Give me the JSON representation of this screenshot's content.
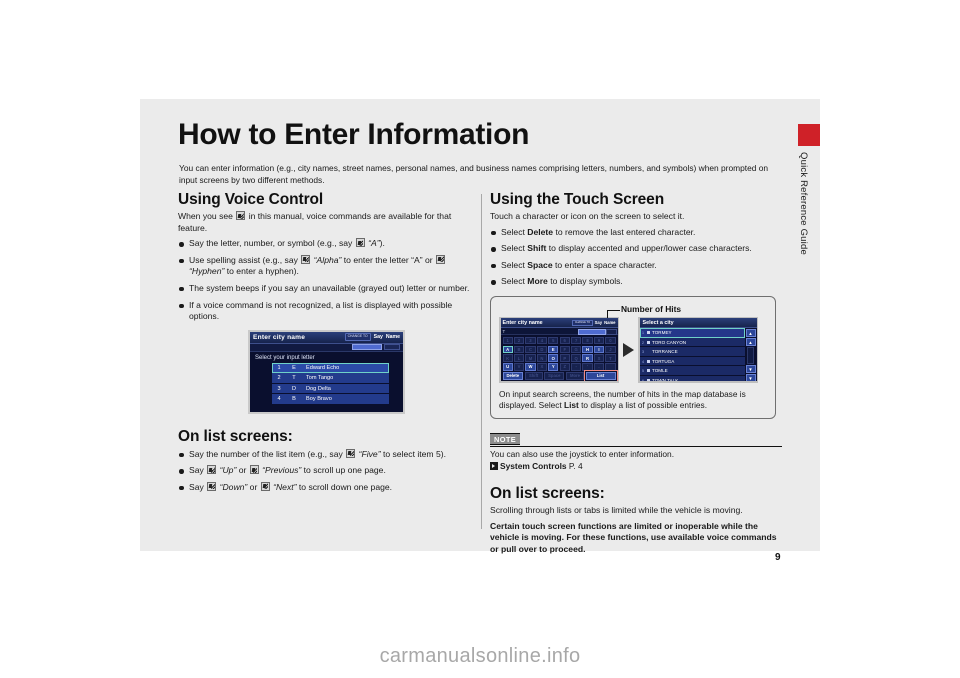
{
  "sheet": {
    "page_number": "9",
    "side_tab_label": "Quick Reference Guide",
    "side_tab_color": "#cf2128",
    "background": "#ebebeb"
  },
  "title": "How to Enter Information",
  "intro": "You can enter information (e.g., city names, street names, personal names, and business names comprising letters, numbers, and symbols) when prompted on input screens by two different methods.",
  "left_column": {
    "heading": "Using Voice Control",
    "lead_part1": "When you see",
    "lead_part2": "in this manual, voice commands are available for that feature.",
    "bullets": [
      {
        "segments": [
          {
            "type": "text",
            "value": "Say the letter, number, or symbol (e.g., say "
          },
          {
            "type": "icon",
            "value": "voice-icon"
          },
          {
            "type": "italic",
            "value": " “A”"
          },
          {
            "type": "text",
            "value": ")."
          }
        ]
      },
      {
        "segments": [
          {
            "type": "text",
            "value": "Use spelling assist (e.g., say "
          },
          {
            "type": "icon",
            "value": "voice-icon"
          },
          {
            "type": "italic",
            "value": " “Alpha”"
          },
          {
            "type": "text",
            "value": " to enter the letter “A” or "
          },
          {
            "type": "icon",
            "value": "voice-icon"
          },
          {
            "type": "italic",
            "value": " “Hyphen”"
          },
          {
            "type": "text",
            "value": " to enter a hyphen)."
          }
        ]
      },
      {
        "segments": [
          {
            "type": "text",
            "value": "The system beeps if you say an unavailable (grayed out) letter or number."
          }
        ]
      },
      {
        "segments": [
          {
            "type": "text",
            "value": "If a voice command is not recognized, a list is displayed with possible options."
          }
        ]
      }
    ],
    "list_heading": "On list screens:",
    "list_bullets": [
      {
        "segments": [
          {
            "type": "text",
            "value": "Say the number of the list item (e.g., say "
          },
          {
            "type": "icon",
            "value": "voice-icon"
          },
          {
            "type": "italic",
            "value": " “Five”"
          },
          {
            "type": "text",
            "value": " to select item 5)."
          }
        ]
      },
      {
        "segments": [
          {
            "type": "text",
            "value": "Say "
          },
          {
            "type": "icon",
            "value": "voice-icon"
          },
          {
            "type": "italic",
            "value": " “Up”"
          },
          {
            "type": "text",
            "value": " or "
          },
          {
            "type": "icon",
            "value": "voice-icon"
          },
          {
            "type": "italic",
            "value": " “Previous”"
          },
          {
            "type": "text",
            "value": " to scroll up one page."
          }
        ]
      },
      {
        "segments": [
          {
            "type": "text",
            "value": "Say "
          },
          {
            "type": "icon",
            "value": "voice-icon"
          },
          {
            "type": "italic",
            "value": " “Down”"
          },
          {
            "type": "text",
            "value": " or "
          },
          {
            "type": "icon",
            "value": "voice-icon"
          },
          {
            "type": "italic",
            "value": " “Next”"
          },
          {
            "type": "text",
            "value": " to scroll down one page."
          }
        ]
      }
    ],
    "nav_screenshot": {
      "header_title": "Enter city name",
      "header_chip": "CHANGE TO",
      "header_buttons": [
        "Say",
        "Name"
      ],
      "instruction": "Select your input letter",
      "rows": [
        {
          "num": "1",
          "letter": "E",
          "word": "Edward Echo",
          "selected": true
        },
        {
          "num": "2",
          "letter": "T",
          "word": "Tom Tango",
          "selected": false
        },
        {
          "num": "3",
          "letter": "D",
          "word": "Dog Delta",
          "selected": false
        },
        {
          "num": "4",
          "letter": "B",
          "word": "Boy Bravo",
          "selected": false
        }
      ]
    }
  },
  "right_column": {
    "heading": "Using the Touch Screen",
    "lead": "Touch a character or icon on the screen to select it.",
    "bullets": [
      {
        "segments": [
          {
            "type": "text",
            "value": "Select "
          },
          {
            "type": "bold",
            "value": "Delete"
          },
          {
            "type": "text",
            "value": " to remove the last entered character."
          }
        ]
      },
      {
        "segments": [
          {
            "type": "text",
            "value": "Select "
          },
          {
            "type": "bold",
            "value": "Shift"
          },
          {
            "type": "text",
            "value": " to display accented and upper/lower case characters."
          }
        ]
      },
      {
        "segments": [
          {
            "type": "text",
            "value": "Select "
          },
          {
            "type": "bold",
            "value": "Space"
          },
          {
            "type": "text",
            "value": " to enter a space character."
          }
        ]
      },
      {
        "segments": [
          {
            "type": "text",
            "value": "Select "
          },
          {
            "type": "bold",
            "value": "More"
          },
          {
            "type": "text",
            "value": " to display symbols."
          }
        ]
      }
    ],
    "figure": {
      "callout_label": "Number of Hits",
      "keyboard_screen": {
        "header_title": "Enter city name",
        "header_chip": "CHANGE TO",
        "header_buttons": [
          "Say",
          "Name"
        ],
        "entered_text": "T",
        "rows": [
          [
            {
              "k": "1",
              "on": false
            },
            {
              "k": "2",
              "on": false
            },
            {
              "k": "3",
              "on": false
            },
            {
              "k": "4",
              "on": false
            },
            {
              "k": "5",
              "on": false
            },
            {
              "k": "6",
              "on": false
            },
            {
              "k": "7",
              "on": false
            },
            {
              "k": "8",
              "on": false
            },
            {
              "k": "9",
              "on": false
            },
            {
              "k": "0",
              "on": false
            }
          ],
          [
            {
              "k": "A",
              "on": true,
              "cursor": true
            },
            {
              "k": "B",
              "on": false
            },
            {
              "k": "C",
              "on": false
            },
            {
              "k": "D",
              "on": false
            },
            {
              "k": "E",
              "on": true
            },
            {
              "k": "F",
              "on": false
            },
            {
              "k": "G",
              "on": false
            },
            {
              "k": "H",
              "on": true
            },
            {
              "k": "I",
              "on": true
            },
            {
              "k": "J",
              "on": false
            }
          ],
          [
            {
              "k": "K",
              "on": false
            },
            {
              "k": "L",
              "on": false
            },
            {
              "k": "M",
              "on": false
            },
            {
              "k": "N",
              "on": false
            },
            {
              "k": "O",
              "on": true
            },
            {
              "k": "P",
              "on": false
            },
            {
              "k": "Q",
              "on": false
            },
            {
              "k": "R",
              "on": true
            },
            {
              "k": "S",
              "on": false
            },
            {
              "k": "T",
              "on": false
            }
          ],
          [
            {
              "k": "U",
              "on": true
            },
            {
              "k": "V",
              "on": false
            },
            {
              "k": "W",
              "on": true
            },
            {
              "k": "X",
              "on": false
            },
            {
              "k": "Y",
              "on": true
            },
            {
              "k": "Z",
              "on": false
            },
            {
              "k": "-",
              "on": false
            },
            {
              "k": "'",
              "on": false
            },
            {
              "k": ".",
              "on": false
            },
            {
              "k": " ",
              "on": false
            }
          ]
        ],
        "bottom_buttons": [
          {
            "label": "Delete",
            "enabled": true,
            "highlight": false
          },
          {
            "label": "Shift",
            "enabled": false,
            "highlight": false
          },
          {
            "label": "Space",
            "enabled": false,
            "highlight": false
          },
          {
            "label": "More",
            "enabled": false,
            "highlight": false
          },
          {
            "label": "List",
            "enabled": true,
            "highlight": true
          }
        ]
      },
      "city_list_screen": {
        "header_title": "Select a city",
        "rows": [
          {
            "n": "1",
            "name": "TORMEY",
            "selected": true,
            "dot": true
          },
          {
            "n": "2",
            "name": "TORO CANYON",
            "selected": false,
            "dot": true
          },
          {
            "n": "3",
            "name": "TORRANCE",
            "selected": false,
            "dot": false
          },
          {
            "n": "4",
            "name": "TORTUGA",
            "selected": false,
            "dot": true
          },
          {
            "n": "5",
            "name": "TOMLE",
            "selected": false,
            "dot": true
          },
          {
            "n": "6",
            "name": "TOWN TALK",
            "selected": false,
            "dot": true
          }
        ],
        "scroll_buttons": [
          "▲",
          "▲",
          "▼",
          "▼"
        ]
      },
      "caption_segments": [
        {
          "type": "text",
          "value": "On input search screens, the number of hits in the map database is displayed. Select "
        },
        {
          "type": "bold",
          "value": "List"
        },
        {
          "type": "text",
          "value": " to display a list of possible entries."
        }
      ]
    },
    "note": {
      "tag": "NOTE",
      "text": "You can also use the joystick to enter information.",
      "reference_label": "System Controls",
      "reference_page": "P. 4"
    },
    "list_heading": "On list screens:",
    "list_text": "Scrolling through lists or tabs is limited while the vehicle is moving.",
    "list_text_bold": "Certain touch screen functions are limited or inoperable while the vehicle is moving. For these functions, use available voice commands or pull over to proceed."
  },
  "watermark": "carmanualsonline.info"
}
